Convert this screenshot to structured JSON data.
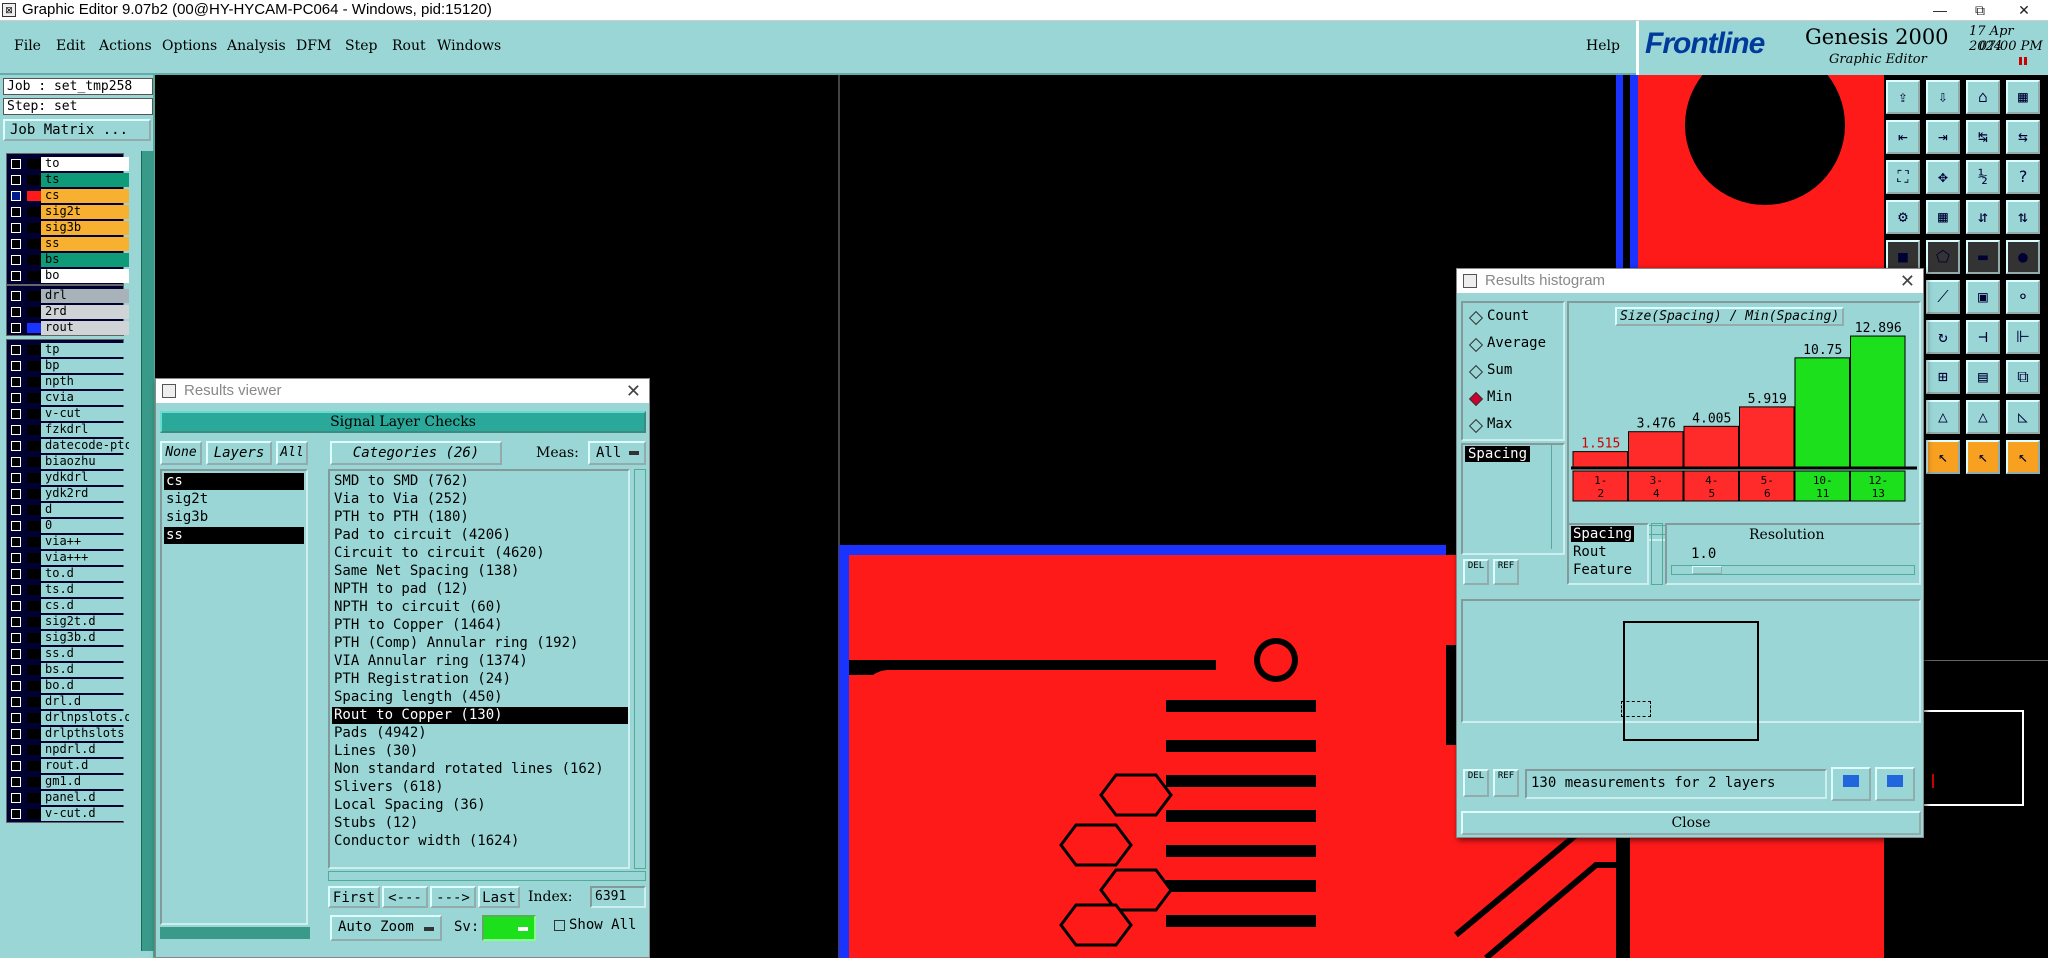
{
  "window": {
    "title": "Graphic Editor 9.07b2 (00@HY-HYCAM-PC064 - Windows, pid:15120)",
    "minimize": "—",
    "restore": "⧉",
    "close": "✕"
  },
  "menu": {
    "items": [
      "File",
      "Edit",
      "Actions",
      "Options",
      "Analysis",
      "DFM",
      "Step",
      "Rout",
      "Windows"
    ],
    "help": "Help"
  },
  "brand": {
    "logo": "Frontline",
    "product": "Genesis 2000",
    "subtitle": "Graphic Editor",
    "date": "17 Apr 2024",
    "time": "07:00 PM"
  },
  "left": {
    "job": "Job : set_tmp258",
    "step": "Step: set",
    "job_matrix": "Job Matrix ...",
    "groups": [
      [
        {
          "name": "to",
          "color": "#ffffff",
          "on": false
        },
        {
          "name": "ts",
          "color": "#0f9b78",
          "on": false
        },
        {
          "name": "cs",
          "color": "#f8b030",
          "on": true,
          "swatch": "#ff1a1a"
        },
        {
          "name": "sig2t",
          "color": "#f8b030",
          "on": false
        },
        {
          "name": "sig3b",
          "color": "#f8b030",
          "on": false
        },
        {
          "name": "ss",
          "color": "#f8b030",
          "on": false
        },
        {
          "name": "bs",
          "color": "#0f9b78",
          "on": false
        },
        {
          "name": "bo",
          "color": "#ffffff",
          "on": false
        }
      ],
      [
        {
          "name": "drl",
          "color": "#a7b3b8",
          "on": false
        },
        {
          "name": "2rd",
          "color": "#d0d4d6",
          "on": false
        },
        {
          "name": "rout",
          "color": "#d0d4d6",
          "on": false,
          "swatch": "#1a33ff"
        }
      ],
      [
        {
          "name": "tp",
          "color": "#9ad6d6",
          "on": false
        },
        {
          "name": "bp",
          "color": "#9ad6d6",
          "on": false
        },
        {
          "name": "npth",
          "color": "#9ad6d6",
          "on": false
        },
        {
          "name": "cvia",
          "color": "#9ad6d6",
          "on": false
        },
        {
          "name": "v-cut",
          "color": "#9ad6d6",
          "on": false
        },
        {
          "name": "fzkdrl",
          "color": "#9ad6d6",
          "on": false
        },
        {
          "name": "datecode-ptc",
          "color": "#9ad6d6",
          "on": false
        },
        {
          "name": "biaozhu",
          "color": "#9ad6d6",
          "on": false
        },
        {
          "name": "ydkdrl",
          "color": "#9ad6d6",
          "on": false
        },
        {
          "name": "ydk2rd",
          "color": "#9ad6d6",
          "on": false
        },
        {
          "name": "d",
          "color": "#9ad6d6",
          "on": false
        },
        {
          "name": "0",
          "color": "#9ad6d6",
          "on": false
        },
        {
          "name": "via++",
          "color": "#9ad6d6",
          "on": false
        },
        {
          "name": "via+++",
          "color": "#9ad6d6",
          "on": false
        },
        {
          "name": "to.d",
          "color": "#9ad6d6",
          "on": false
        },
        {
          "name": "ts.d",
          "color": "#9ad6d6",
          "on": false
        },
        {
          "name": "cs.d",
          "color": "#9ad6d6",
          "on": false
        },
        {
          "name": "sig2t.d",
          "color": "#9ad6d6",
          "on": false
        },
        {
          "name": "sig3b.d",
          "color": "#9ad6d6",
          "on": false
        },
        {
          "name": "ss.d",
          "color": "#9ad6d6",
          "on": false
        },
        {
          "name": "bs.d",
          "color": "#9ad6d6",
          "on": false
        },
        {
          "name": "bo.d",
          "color": "#9ad6d6",
          "on": false
        },
        {
          "name": "drl.d",
          "color": "#9ad6d6",
          "on": false
        },
        {
          "name": "drlnpslots.d",
          "color": "#9ad6d6",
          "on": false
        },
        {
          "name": "drlpthslots",
          "color": "#9ad6d6",
          "on": false
        },
        {
          "name": "npdrl.d",
          "color": "#9ad6d6",
          "on": false
        },
        {
          "name": "rout.d",
          "color": "#9ad6d6",
          "on": false
        },
        {
          "name": "gm1.d",
          "color": "#9ad6d6",
          "on": false
        },
        {
          "name": "panel.d",
          "color": "#9ad6d6",
          "on": false
        },
        {
          "name": "v-cut.d",
          "color": "#9ad6d6",
          "on": false
        }
      ]
    ]
  },
  "results_viewer": {
    "title": "Results viewer",
    "header": "Signal Layer Checks",
    "none": "None",
    "layers": "Layers",
    "all": "All",
    "categories_btn": "Categories (26)",
    "meas_label": "Meas:",
    "meas_value": "All",
    "layers_list": [
      "cs",
      "sig2t",
      "sig3b",
      "ss"
    ],
    "categories": [
      "SMD to SMD (762)",
      "Via to Via (252)",
      "PTH to PTH (180)",
      "Pad to circuit (4206)",
      "Circuit to circuit (4620)",
      "Same Net Spacing (138)",
      "NPTH to pad (12)",
      "NPTH to circuit (60)",
      "PTH to Copper (1464)",
      "PTH (Comp) Annular ring (192)",
      "VIA Annular ring (1374)",
      "PTH Registration (24)",
      "Spacing length (450)",
      "Rout to Copper (130)",
      "Pads (4942)",
      "Lines (30)",
      "Non standard rotated lines (162)",
      "Slivers (618)",
      "Local Spacing (36)",
      "Stubs (12)",
      "Conductor width (1624)"
    ],
    "selected_category": "Rout to Copper (130)",
    "nav": {
      "first": "First",
      "prev": "<---",
      "next": "--->",
      "last": "Last",
      "index_label": "Index:",
      "index_value": "6391"
    },
    "auto_zoom": "Auto Zoom",
    "sv_label": "Sv:",
    "show_all": "Show All"
  },
  "histogram": {
    "title": "Results histogram",
    "modes": [
      "Count",
      "Average",
      "Sum",
      "Min",
      "Max"
    ],
    "mode_selected": "Min",
    "list_item": "Spacing",
    "chart_title": "Size(Spacing) / Min(Spacing)",
    "types": [
      "Spacing",
      "Rout",
      "Feature"
    ],
    "type_selected": "Spacing",
    "resolution_label": "Resolution",
    "resolution_value": "1.0",
    "del": "DEL",
    "ref": "REF",
    "status": "130 measurements for 2 layers",
    "close": "Close"
  },
  "chart_data": {
    "type": "bar",
    "title": "Size(Spacing) / Min(Spacing)",
    "categories": [
      "1-2",
      "3-4",
      "4-5",
      "5-6",
      "10-11",
      "12-13"
    ],
    "values": [
      1.515,
      3.476,
      4.005,
      5.919,
      10.75,
      12.896
    ],
    "value_labels": [
      "1.515",
      "3.476",
      "4.005",
      "5.919",
      "10.75",
      "12.896"
    ],
    "category_labels": [
      [
        "1-",
        "2"
      ],
      [
        "3-",
        "4"
      ],
      [
        "4-",
        "5"
      ],
      [
        "5-",
        "6"
      ],
      [
        "10-",
        "11"
      ],
      [
        "12-",
        "13"
      ]
    ],
    "colors": [
      "#ff2a2a",
      "#ff2a2a",
      "#ff2a2a",
      "#ff2a2a",
      "#1de01d",
      "#1de01d"
    ],
    "ylim": [
      0,
      13
    ]
  }
}
